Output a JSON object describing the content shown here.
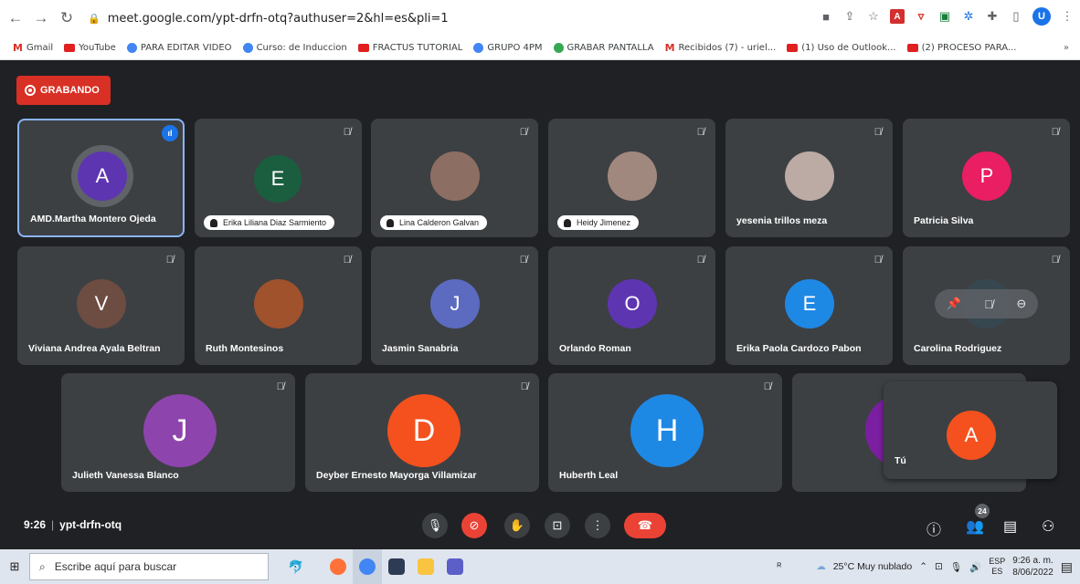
{
  "browser": {
    "url": "meet.google.com/ypt-drfn-otq?authuser=2&hl=es&pli=1",
    "profile_initial": "U",
    "bookmarks": [
      "Gmail",
      "YouTube",
      "PARA EDITAR VIDEO",
      "Curso: de Induccion",
      "FRACTUS TUTORIAL",
      "GRUPO 4PM",
      "GRABAR PANTALLA",
      "Recibidos (7) - uriel...",
      "(1) Uso de Outlook...",
      "(2) PROCESO PARA..."
    ],
    "more": "»"
  },
  "recording": {
    "label": "GRABANDO",
    "color": "#d93025"
  },
  "participants": [
    {
      "name": "AMD.Martha Montero Ojeda",
      "initial": "A",
      "color": "#5e35b1"
    },
    {
      "name": "Erika Liliana Diaz Sarmiento",
      "initial": "E",
      "color": "#1b5e3f"
    },
    {
      "name": "Lina Calderon Galvan",
      "initial": "",
      "color": "#8d6e63"
    },
    {
      "name": "Heidy Jimenez",
      "initial": "",
      "color": "#a1887f"
    },
    {
      "name": "yesenia trillos meza",
      "initial": "",
      "color": "#bcaaa4"
    },
    {
      "name": "Patricia Silva",
      "initial": "P",
      "color": "#e91e63"
    },
    {
      "name": "Viviana Andrea Ayala Beltran",
      "initial": "V",
      "color": "#6d4c41"
    },
    {
      "name": "Ruth Montesinos",
      "initial": "",
      "color": "#a0522d"
    },
    {
      "name": "Jasmin Sanabria",
      "initial": "J",
      "color": "#5c6bc0"
    },
    {
      "name": "Orlando Roman",
      "initial": "O",
      "color": "#5e35b1"
    },
    {
      "name": "Erika Paola Cardozo Pabon",
      "initial": "E",
      "color": "#1e88e5"
    },
    {
      "name": "Carolina Rodriguez",
      "initial": "",
      "color": "#37474f"
    },
    {
      "name": "Julieth Vanessa Blanco",
      "initial": "J",
      "color": "#8e44ad"
    },
    {
      "name": "Deyber Ernesto Mayorga Villamizar",
      "initial": "D",
      "color": "#f4511e"
    },
    {
      "name": "Huberth Leal",
      "initial": "H",
      "color": "#1e88e5"
    },
    {
      "name": "",
      "initial": "",
      "color": "#7b1fa2"
    }
  ],
  "self": {
    "name": "Tú",
    "initial": "A",
    "color": "#f4511e"
  },
  "meeting": {
    "time": "9:26",
    "separator": "|",
    "code": "ypt-drfn-otq",
    "participant_count": "24"
  },
  "taskbar": {
    "search_placeholder": "Escribe aquí para buscar",
    "weather": "25°C  Muy nublado",
    "lang_top": "ESP",
    "lang_bottom": "ES",
    "clock_time": "9:26 a. m.",
    "clock_date": "8/06/2022"
  }
}
